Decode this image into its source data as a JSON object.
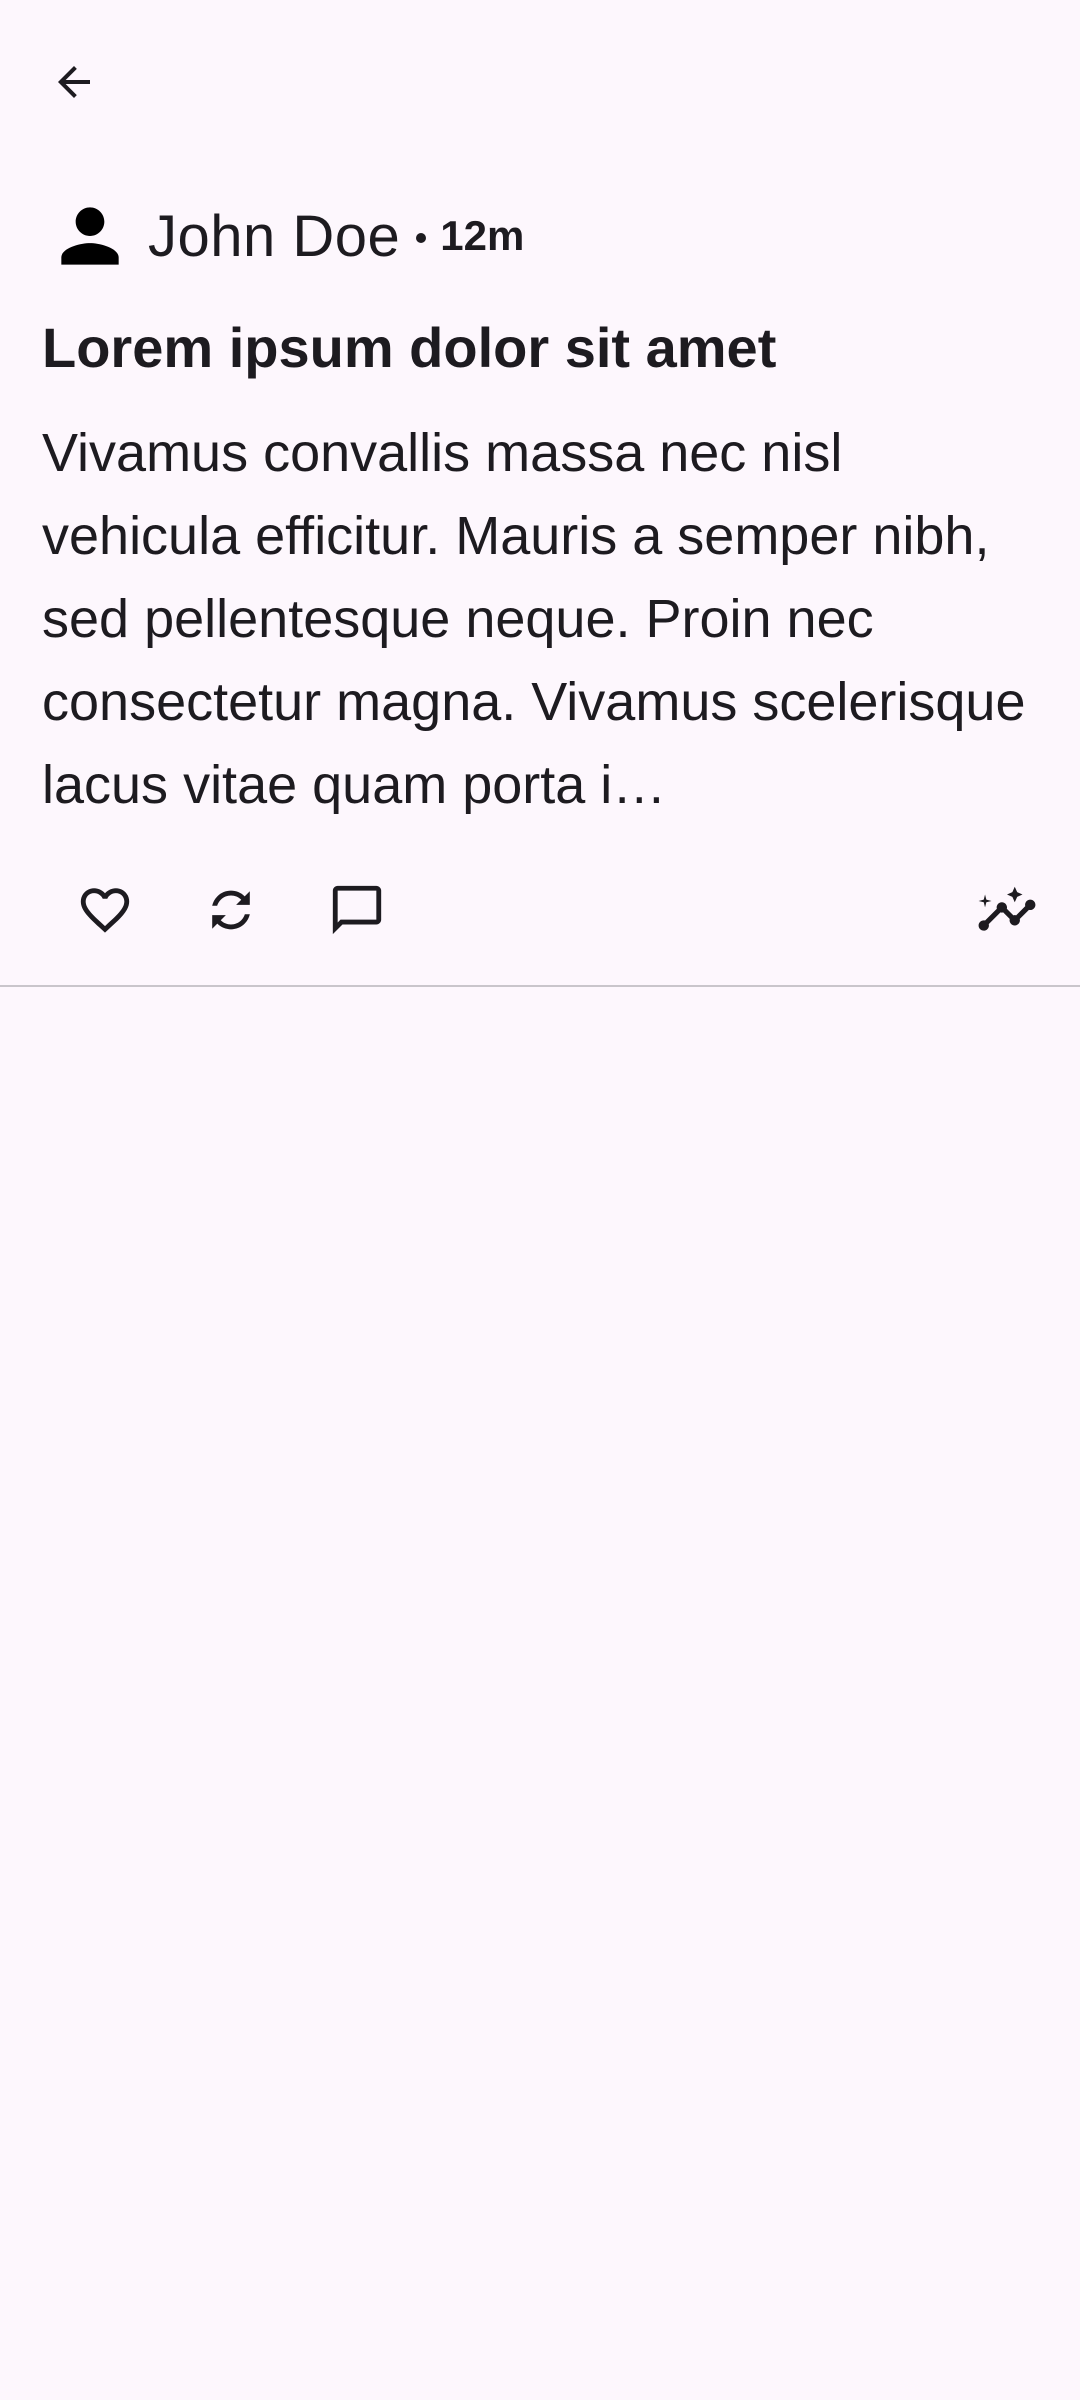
{
  "header": {
    "back_icon": "arrow-back-icon"
  },
  "post": {
    "author": "John Doe",
    "time": "12m",
    "avatar_icon": "person-icon",
    "title": "Lorem ipsum dolor sit amet",
    "body": "Vivamus convallis massa nec nisl vehicula efficitur. Mauris a semper nibh, sed pellentesque neque. Proin nec consectetur magna. Vivamus scelerisque lacus vitae quam porta i…",
    "actions": [
      {
        "name": "like",
        "icon": "heart-outline-icon"
      },
      {
        "name": "repost",
        "icon": "sync-icon"
      },
      {
        "name": "comment",
        "icon": "comment-icon"
      },
      {
        "name": "insights",
        "icon": "insights-sparkle-icon"
      }
    ]
  },
  "colors": {
    "background": "#FDF7FD",
    "text": "#1D1B20",
    "divider": "#C9C5CB"
  }
}
